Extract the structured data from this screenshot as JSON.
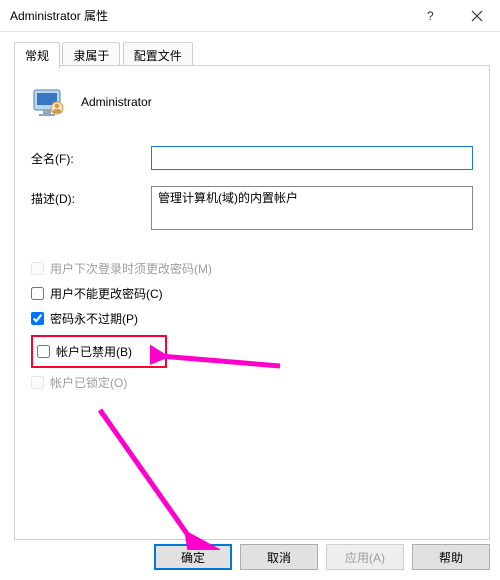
{
  "window": {
    "title": "Administrator 属性"
  },
  "tabs": {
    "t0": "常规",
    "t1": "隶属于",
    "t2": "配置文件"
  },
  "user": {
    "display_name": "Administrator"
  },
  "form": {
    "fullname_label": "全名(F):",
    "fullname_value": "",
    "desc_label": "描述(D):",
    "desc_value": "管理计算机(域)的内置帐户"
  },
  "checks": {
    "must_change": "用户下次登录时须更改密码(M)",
    "cannot_change": "用户不能更改密码(C)",
    "never_expires": "密码永不过期(P)",
    "disabled": "帐户已禁用(B)",
    "locked": "帐户已锁定(O)"
  },
  "buttons": {
    "ok": "确定",
    "cancel": "取消",
    "apply": "应用(A)",
    "help": "帮助"
  }
}
